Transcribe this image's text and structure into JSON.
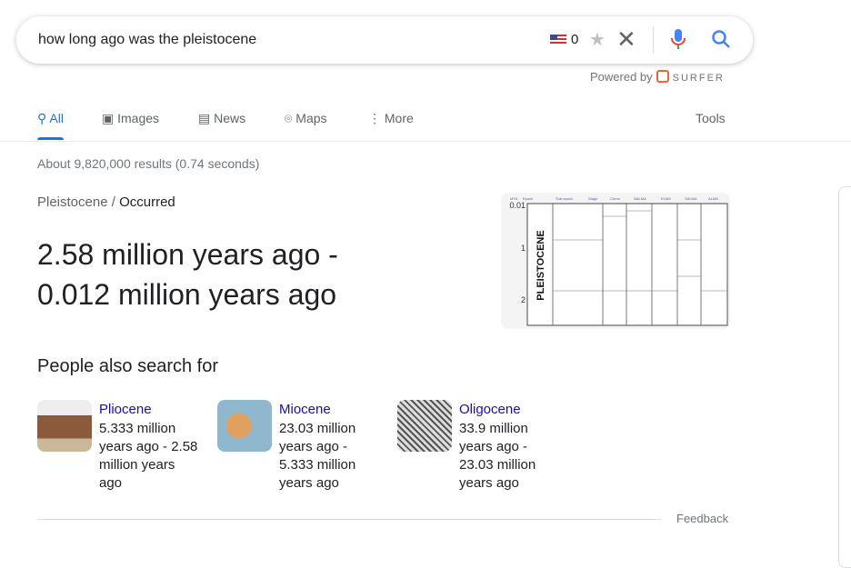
{
  "search": {
    "query": "how long ago was the pleistocene",
    "count": "0",
    "flag_icon": "us-flag-icon",
    "powered_by": "Powered by",
    "powered_brand": "SURFER"
  },
  "tabs": [
    {
      "label": "All",
      "icon": "search-icon"
    },
    {
      "label": "Images",
      "icon": "image-icon"
    },
    {
      "label": "News",
      "icon": "news-icon"
    },
    {
      "label": "Maps",
      "icon": "map-pin-icon"
    },
    {
      "label": "More",
      "icon": "more-vert-icon"
    }
  ],
  "tools": "Tools",
  "stats": "About 9,820,000 results (0.74 seconds)",
  "breadcrumb": {
    "parent": "Pleistocene",
    "sep": "/",
    "current": "Occurred"
  },
  "answer": {
    "line1": "2.58 million years ago -",
    "line2": "0.012 million years ago"
  },
  "chart_image": {
    "title": "PLEISTOCENE",
    "ticks": [
      "0.01",
      "1",
      "2"
    ],
    "headers": [
      "MYA",
      "Epoch",
      "Sub-epoch",
      "Stage",
      "Chron",
      "NALMA",
      "ELMA",
      "SALMA",
      "ALMA"
    ]
  },
  "people_also": {
    "title": "People also search for",
    "items": [
      {
        "name": "Pliocene",
        "desc": "5.333 million years ago - 2.58 million years ago"
      },
      {
        "name": "Miocene",
        "desc": "23.03 million years ago - 5.333 million years ago"
      },
      {
        "name": "Oligocene",
        "desc": "33.9 million years ago - 23.03 million years ago"
      }
    ]
  },
  "feedback": "Feedback",
  "colors": {
    "accent": "#1a73e8",
    "link": "#1a0dab"
  }
}
